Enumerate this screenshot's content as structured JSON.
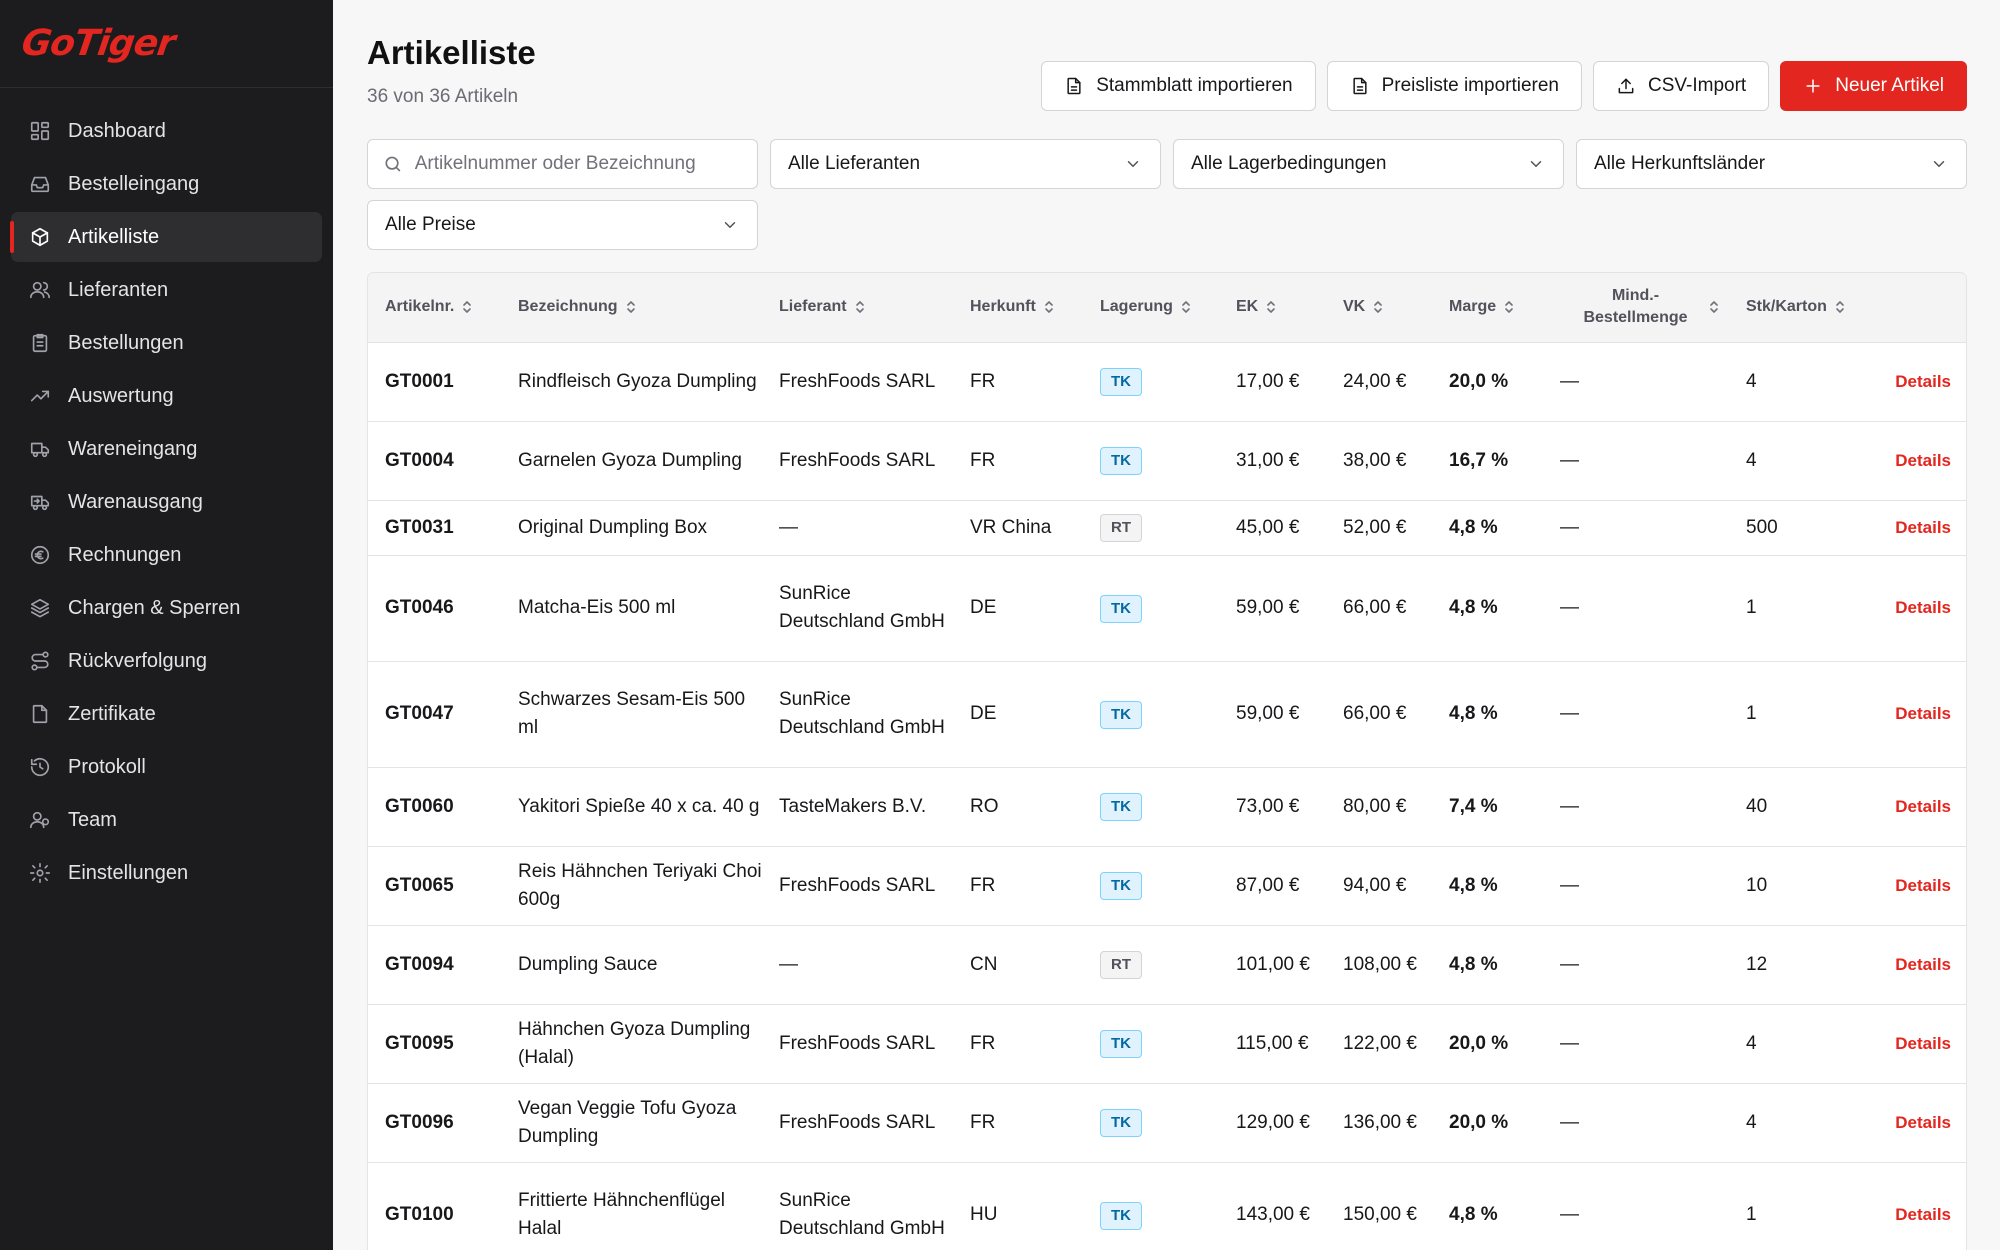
{
  "brand": {
    "name": "GoTiger",
    "accent": "#e3261f"
  },
  "sidebar": {
    "items": [
      {
        "label": "Dashboard",
        "icon": "dashboard-icon",
        "active": false
      },
      {
        "label": "Bestelleingang",
        "icon": "inbox-icon",
        "active": false
      },
      {
        "label": "Artikelliste",
        "icon": "box-icon",
        "active": true
      },
      {
        "label": "Lieferanten",
        "icon": "users-icon",
        "active": false
      },
      {
        "label": "Bestellungen",
        "icon": "clipboard-icon",
        "active": false
      },
      {
        "label": "Auswertung",
        "icon": "trending-up-icon",
        "active": false
      },
      {
        "label": "Wareneingang",
        "icon": "truck-in-icon",
        "active": false
      },
      {
        "label": "Warenausgang",
        "icon": "truck-out-icon",
        "active": false
      },
      {
        "label": "Rechnungen",
        "icon": "euro-icon",
        "active": false
      },
      {
        "label": "Chargen & Sperren",
        "icon": "layers-icon",
        "active": false
      },
      {
        "label": "Rückverfolgung",
        "icon": "route-icon",
        "active": false
      },
      {
        "label": "Zertifikate",
        "icon": "file-icon",
        "active": false
      },
      {
        "label": "Protokoll",
        "icon": "history-icon",
        "active": false
      },
      {
        "label": "Team",
        "icon": "team-icon",
        "active": false
      },
      {
        "label": "Einstellungen",
        "icon": "gear-icon",
        "active": false
      }
    ]
  },
  "header": {
    "title": "Artikelliste",
    "subtitle": "36 von 36 Artikeln",
    "buttons": {
      "stammblatt": "Stammblatt importieren",
      "preisliste": "Preisliste importieren",
      "csv": "CSV-Import",
      "neu": "Neuer Artikel"
    }
  },
  "filters": {
    "search_placeholder": "Artikelnummer oder Bezeichnung",
    "lieferanten": "Alle Lieferanten",
    "lagerbedingungen": "Alle Lagerbedingungen",
    "herkunft": "Alle Herkunftsländer",
    "preise": "Alle Preise"
  },
  "table": {
    "columns": [
      "Artikelnr.",
      "Bezeichnung",
      "Lieferant",
      "Herkunft",
      "Lagerung",
      "EK",
      "VK",
      "Marge",
      "Mind.-Bestellmenge",
      "Stk/Karton"
    ],
    "details_label": "Details",
    "rows": [
      {
        "nr": "GT0001",
        "bez": "Rindfleisch Gyoza Dumpling",
        "lief": "FreshFoods SARL",
        "herk": "FR",
        "lager": "TK",
        "ek": "17,00 €",
        "vk": "24,00 €",
        "marge": "20,0 %",
        "mind": "—",
        "stk": "4"
      },
      {
        "nr": "GT0004",
        "bez": "Garnelen Gyoza Dumpling",
        "lief": "FreshFoods SARL",
        "herk": "FR",
        "lager": "TK",
        "ek": "31,00 €",
        "vk": "38,00 €",
        "marge": "16,7 %",
        "mind": "—",
        "stk": "4"
      },
      {
        "nr": "GT0031",
        "bez": "Original Dumpling Box",
        "lief": "—",
        "herk": "VR China",
        "lager": "RT",
        "ek": "45,00 €",
        "vk": "52,00 €",
        "marge": "4,8 %",
        "mind": "—",
        "stk": "500"
      },
      {
        "nr": "GT0046",
        "bez": "Matcha-Eis 500 ml",
        "lief": "SunRice Deutschland GmbH",
        "herk": "DE",
        "lager": "TK",
        "ek": "59,00 €",
        "vk": "66,00 €",
        "marge": "4,8 %",
        "mind": "—",
        "stk": "1"
      },
      {
        "nr": "GT0047",
        "bez": "Schwarzes Sesam-Eis 500 ml",
        "lief": "SunRice Deutschland GmbH",
        "herk": "DE",
        "lager": "TK",
        "ek": "59,00 €",
        "vk": "66,00 €",
        "marge": "4,8 %",
        "mind": "—",
        "stk": "1"
      },
      {
        "nr": "GT0060",
        "bez": "Yakitori Spieße 40 x ca. 40 g",
        "lief": "TasteMakers B.V.",
        "herk": "RO",
        "lager": "TK",
        "ek": "73,00 €",
        "vk": "80,00 €",
        "marge": "7,4 %",
        "mind": "—",
        "stk": "40"
      },
      {
        "nr": "GT0065",
        "bez": "Reis Hähnchen Teriyaki Choi 600g",
        "lief": "FreshFoods SARL",
        "herk": "FR",
        "lager": "TK",
        "ek": "87,00 €",
        "vk": "94,00 €",
        "marge": "4,8 %",
        "mind": "—",
        "stk": "10"
      },
      {
        "nr": "GT0094",
        "bez": "Dumpling Sauce",
        "lief": "—",
        "herk": "CN",
        "lager": "RT",
        "ek": "101,00 €",
        "vk": "108,00 €",
        "marge": "4,8 %",
        "mind": "—",
        "stk": "12"
      },
      {
        "nr": "GT0095",
        "bez": "Hähnchen Gyoza Dumpling (Halal)",
        "lief": "FreshFoods SARL",
        "herk": "FR",
        "lager": "TK",
        "ek": "115,00 €",
        "vk": "122,00 €",
        "marge": "20,0 %",
        "mind": "—",
        "stk": "4"
      },
      {
        "nr": "GT0096",
        "bez": "Vegan Veggie Tofu Gyoza Dumpling",
        "lief": "FreshFoods SARL",
        "herk": "FR",
        "lager": "TK",
        "ek": "129,00 €",
        "vk": "136,00 €",
        "marge": "20,0 %",
        "mind": "—",
        "stk": "4"
      },
      {
        "nr": "GT0100",
        "bez": "Frittierte Hähnchenflügel Halal",
        "lief": "SunRice Deutschland GmbH",
        "herk": "HU",
        "lager": "TK",
        "ek": "143,00 €",
        "vk": "150,00 €",
        "marge": "4,8 %",
        "mind": "—",
        "stk": "1"
      }
    ]
  }
}
